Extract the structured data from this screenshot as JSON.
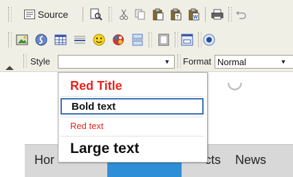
{
  "toolbar": {
    "source_label": "Source",
    "style_label": "Style",
    "style_value": "",
    "format_label": "Format",
    "format_value": "Normal",
    "icons_row1": [
      "source-icon",
      "preview-icon",
      "cut-icon",
      "copy-icon",
      "paste-icon",
      "paste-text-icon",
      "paste-word-icon",
      "print-icon",
      "undo-icon"
    ],
    "icons_row2": [
      "image-icon",
      "flash-icon",
      "table-icon",
      "horizontal-rule-icon",
      "smiley-icon",
      "special-char-icon",
      "page-break-icon",
      "iframe-icon",
      "form-icon",
      "radio-icon"
    ]
  },
  "style_dropdown": {
    "options": [
      "Red Title",
      "Bold text",
      "Red text",
      "Large text"
    ],
    "highlighted": "Bold text"
  },
  "nav": {
    "items": [
      "Hor",
      "cts",
      "News"
    ]
  },
  "colors": {
    "toolbar_bg": "#f0efe6",
    "red_style": "#e8241e",
    "nav_bg": "#d8d8d8",
    "nav_active": "#2e8ed6",
    "highlight_border": "#3a6fb5"
  }
}
